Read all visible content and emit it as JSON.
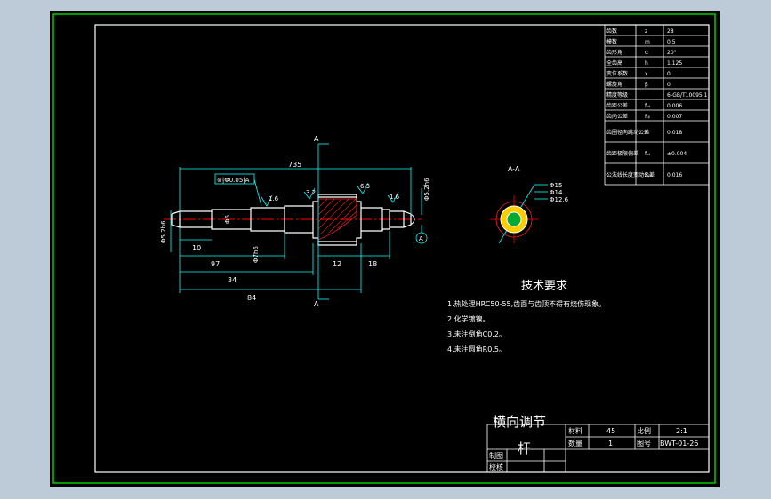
{
  "colors": {
    "background": "#000000",
    "frame": "#ffffff",
    "inner_border": "#00cc00",
    "part": "#ffffff",
    "dimension": "#00ffff",
    "centerline": "#ff0000",
    "hatch": "#ff2020",
    "section_fill": "#ffcc00",
    "text": "#ffffff"
  },
  "section_label_top": "A",
  "section_label_bottom": "A",
  "section_view_label": "A-A",
  "dims": {
    "overall": "735",
    "d10": "10",
    "d97": "97",
    "d34": "34",
    "d84": "84",
    "d12": "12",
    "d18": "18",
    "tol": "⊚|Φ0.05|A",
    "r16a": "1.6",
    "r32": "3.2",
    "r63": "6.3",
    "r16b": "1.6",
    "dia_left": "Φ5.2h6",
    "dia_mid1": "Φ6",
    "dia_mid2": "Φ7h6",
    "dia_right": "Φ5.2h6",
    "datum": "A",
    "sec_d15": "Φ15",
    "sec_d14": "Φ14",
    "sec_d126": "Φ12.6"
  },
  "params": [
    {
      "name": "齿数",
      "sym": "z",
      "val": "28"
    },
    {
      "name": "模数",
      "sym": "m",
      "val": "0.5"
    },
    {
      "name": "齿形角",
      "sym": "α",
      "val": "20°"
    },
    {
      "name": "全齿高",
      "sym": "h",
      "val": "1.125"
    },
    {
      "name": "变位系数",
      "sym": "x",
      "val": "0"
    },
    {
      "name": "螺旋角",
      "sym": "β",
      "val": "0"
    },
    {
      "name": "精度等级",
      "sym": "",
      "val": "6-GB/T10095.1"
    },
    {
      "name": "齿距公差",
      "sym": "fₚₜ",
      "val": "0.006"
    },
    {
      "name": "齿向公差",
      "sym": "Fᵦ",
      "val": "0.007"
    },
    {
      "name": "齿圈径向跳动公差",
      "sym": "Fᵣ",
      "val": "0.018"
    },
    {
      "name": "齿距极限偏差",
      "sym": "fₚₜ",
      "val": "±0.004"
    },
    {
      "name": "公法线长度变动公差",
      "sym": "Fᵥᵥ",
      "val": "0.016"
    }
  ],
  "tech": {
    "title": "技术要求",
    "items": [
      "1.热处理HRC50-55,齿面与齿顶不得有烧伤现象。",
      "2.化学镀镍。",
      "3.未注倒角C0.2。",
      "4.未注圆角R0.5。"
    ]
  },
  "title_block": {
    "part_name_1": "横向调节",
    "part_name_2": "杆",
    "material_label": "材料",
    "material": "45",
    "scale_label": "比例",
    "scale": "2:1",
    "qty_label": "数量",
    "qty": "1",
    "drawing_no_label": "图号",
    "drawing_no": "BWT-01-26",
    "drawn_label": "制图",
    "checked_label": "校核"
  }
}
